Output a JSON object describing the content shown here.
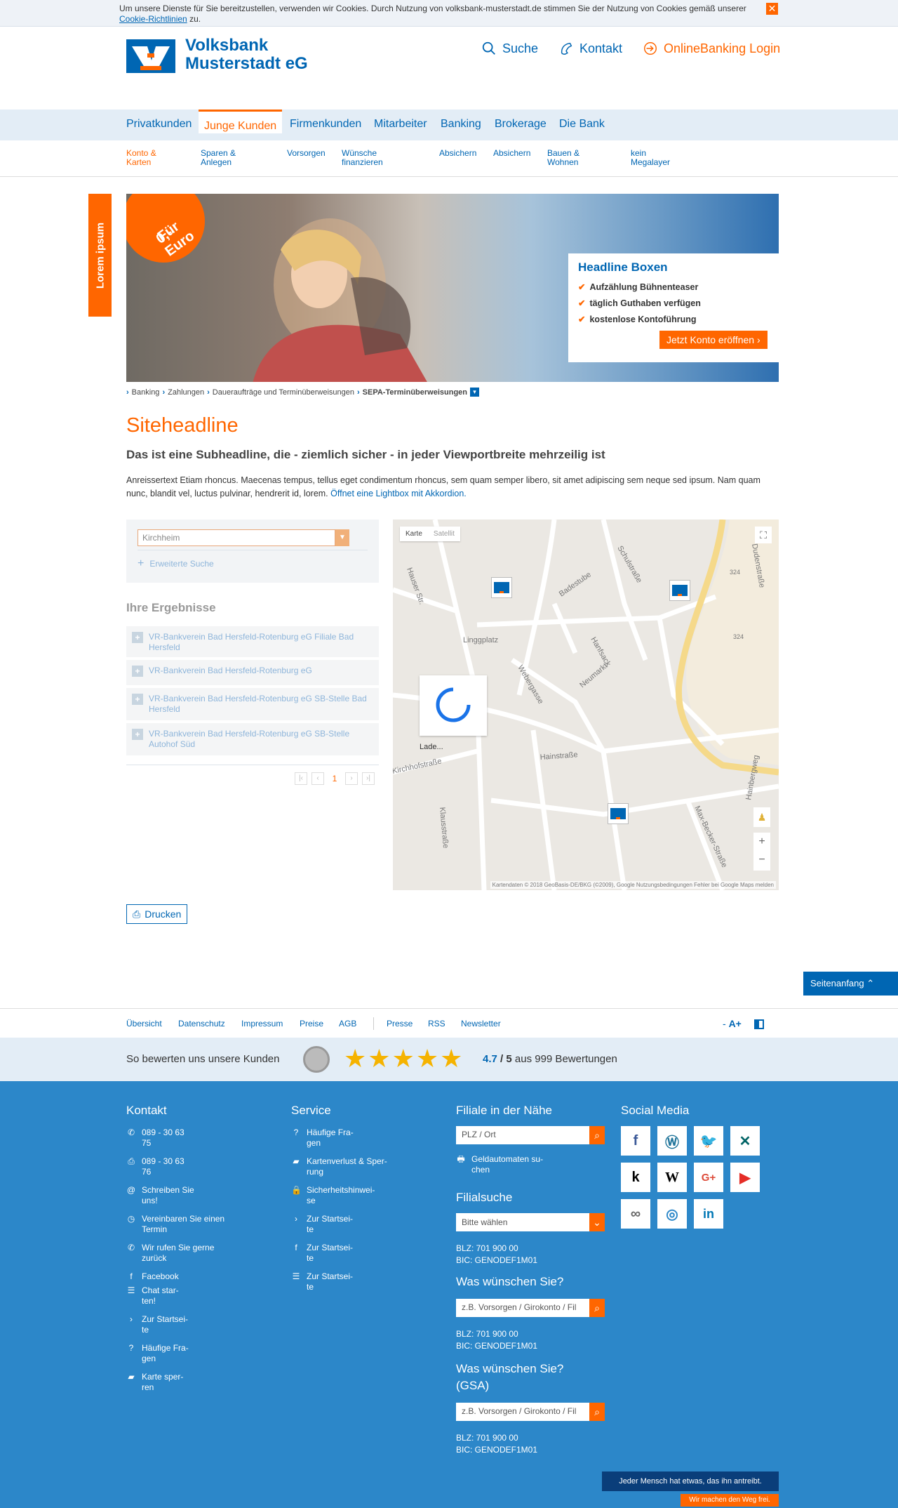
{
  "cookie": {
    "text": "Um unsere Dienste für Sie bereitzustellen, verwenden wir Cookies. Durch Nutzung von volksbank-musterstadt.de stimmen Sie der Nutzung von Cookies gemäß unserer",
    "link": "Cookie-Richtlinien",
    "suffix": "zu.",
    "close": "✕"
  },
  "header": {
    "logo_line1": "Volksbank",
    "logo_line2": "Musterstadt eG",
    "search": "Suche",
    "contact": "Kontakt",
    "login": "OnlineBanking Login"
  },
  "mainnav": [
    "Privatkunden",
    "Junge Kunden",
    "Firmenkunden",
    "Mitarbeiter",
    "Banking",
    "Brokerage",
    "Die Bank"
  ],
  "subnav": [
    {
      "l1": "Konto &",
      "l2": "Karten"
    },
    {
      "l1": "Sparen &",
      "l2": "Anlegen"
    },
    {
      "l1": "Vorsorgen",
      "l2": ""
    },
    {
      "l1": "Wünsche",
      "l2": "finanzieren"
    },
    {
      "l1": "Absichern",
      "l2": ""
    },
    {
      "l1": "Absichern",
      "l2": ""
    },
    {
      "l1": "Bauen &",
      "l2": "Wohnen"
    },
    {
      "l1": "kein",
      "l2": "Megalayer"
    }
  ],
  "sidetab": "Lorem ipsum",
  "hero": {
    "badge_l1": "Für",
    "badge_l2": "0,- Euro",
    "box_title": "Headline Boxen",
    "items": [
      "Aufzählung Bühnenteaser",
      "täglich Guthaben verfügen",
      "kostenlose Kontoführung"
    ],
    "cta": "Jetzt Konto eröffnen"
  },
  "breadcrumb": [
    "Banking",
    "Zahlungen",
    "Daueraufträge und Terminüberweisungen",
    "SEPA-Terminüberweisungen"
  ],
  "content": {
    "h1": "Siteheadline",
    "h2": "Das ist eine Subheadline, die - ziemlich sicher - in jeder Viewportbreite mehrzeilig ist",
    "lead": "Anreissertext Etiam rhoncus. Maecenas tempus, tellus eget condimentum rhoncus, sem quam semper libero, sit amet adipiscing sem neque sed ipsum. Nam quam nunc, blandit vel, luctus pulvinar, hendrerit id, lorem.",
    "lead_link": "Öffnet eine Lightbox mit Akkordion."
  },
  "finder": {
    "value": "Kirchheim",
    "advanced": "Erweiterte Suche",
    "results_title": "Ihre Ergebnisse",
    "results": [
      "VR-Bankverein Bad Hersfeld-Rotenburg eG Filiale Bad Hersfeld",
      "VR-Bankverein Bad Hersfeld-Rotenburg eG",
      "VR-Bankverein Bad Hersfeld-Rotenburg eG SB-Stelle Bad Hersfeld",
      "VR-Bankverein Bad Hersfeld-Rotenburg eG SB-Stelle Autohof Süd"
    ],
    "page": "1"
  },
  "map": {
    "tab_map": "Karte",
    "tab_sat": "Satellit",
    "loading": "Lade...",
    "attribution": "Kartendaten © 2018 GeoBasis-DE/BKG (©2009), Google   Nutzungsbedingungen   Fehler bei Google Maps melden",
    "labels": [
      "Linggplatz",
      "Hainstraße",
      "Neumarkt",
      "Webergasse",
      "Badestube",
      "Schulstraße",
      "Dudenstraße",
      "Hanfsack",
      "Hauser Str.",
      "Kirchhofstraße",
      "Max-Becker-Straße",
      "Klausstraße",
      "Hainbergweg",
      "324",
      "324"
    ]
  },
  "print": "Drucken",
  "totop": "Seitenanfang",
  "footer_links": [
    "Übersicht",
    "Datenschutz",
    "Impressum",
    "Preise",
    "AGB",
    "Presse",
    "RSS",
    "Newsletter"
  ],
  "fontsize": {
    "minus": "-",
    "plus": "A+"
  },
  "rating": {
    "label": "So bewerten uns unsere Kunden",
    "score": "4.7",
    "of": "/ 5",
    "count": "aus 999 Bewertungen",
    "stars": 5
  },
  "foot": {
    "kontakt_title": "Kontakt",
    "kontakt": [
      {
        "icon": "phone-icon",
        "g": "✆",
        "l1": "089 - 30 63",
        "l2": "75"
      },
      {
        "icon": "fax-icon",
        "g": "⎙",
        "l1": "089 - 30 63",
        "l2": "76"
      },
      {
        "icon": "at-icon",
        "g": "@",
        "l1": "Schreiben Sie",
        "l2": "uns!"
      },
      {
        "icon": "clock-icon",
        "g": "◷",
        "l1": "Vereinbaren Sie einen",
        "l2": "Termin"
      },
      {
        "icon": "callback-icon",
        "g": "✆",
        "l1": "Wir rufen Sie gerne",
        "l2": "zurück"
      },
      {
        "icon": "facebook-icon",
        "g": "f",
        "l1": "Facebook",
        "l2": ""
      },
      {
        "icon": "chat-icon",
        "g": "☰",
        "l1": "Chat star-",
        "l2": "ten!"
      },
      {
        "icon": "chevron-right-icon",
        "g": "›",
        "l1": "Zur Startsei-",
        "l2": "te"
      },
      {
        "icon": "faq-icon",
        "g": "?",
        "l1": "Häufige Fra-",
        "l2": "gen"
      },
      {
        "icon": "card-block-icon",
        "g": "▰",
        "l1": "Karte sper-",
        "l2": "ren"
      }
    ],
    "service_title": "Service",
    "service": [
      {
        "icon": "faq-icon",
        "g": "?",
        "l1": "Häufige Fra-",
        "l2": "gen"
      },
      {
        "icon": "card-block-icon",
        "g": "▰",
        "l1": "Kartenverlust & Sper-",
        "l2": "rung"
      },
      {
        "icon": "lock-icon",
        "g": "🔒",
        "l1": "Sicherheitshinwei-",
        "l2": "se"
      },
      {
        "icon": "chevron-right-icon",
        "g": "›",
        "l1": "Zur Startsei-",
        "l2": "te"
      },
      {
        "icon": "facebook-icon",
        "g": "f",
        "l1": "Zur Startsei-",
        "l2": "te"
      },
      {
        "icon": "chat-icon",
        "g": "☰",
        "l1": "Zur Startsei-",
        "l2": "te"
      }
    ],
    "filiale_title": "Filiale in der Nähe",
    "plz_placeholder": "PLZ / Ort",
    "atm_l1": "Geldautomaten su-",
    "atm_l2": "chen",
    "filialsuche_title": "Filialsuche",
    "select_value": "Bitte wählen",
    "blz": "BLZ: 701 900 00",
    "bic": "BIC: GENODEF1M01",
    "wish_title": "Was wünschen Sie?",
    "wish_placeholder": "z.B. Vorsorgen / Girokonto / Fil",
    "wish2_title_l1": "Was wünschen Sie?",
    "wish2_title_l2": "(GSA)",
    "social_title": "Social Media",
    "claim1": "Jeder Mensch hat etwas, das ihn antreibt.",
    "claim2": "Wir machen den Weg frei."
  },
  "colors": {
    "brand_blue": "#0066b3",
    "brand_orange": "#ff6600",
    "footer_blue": "#2c87c9"
  }
}
